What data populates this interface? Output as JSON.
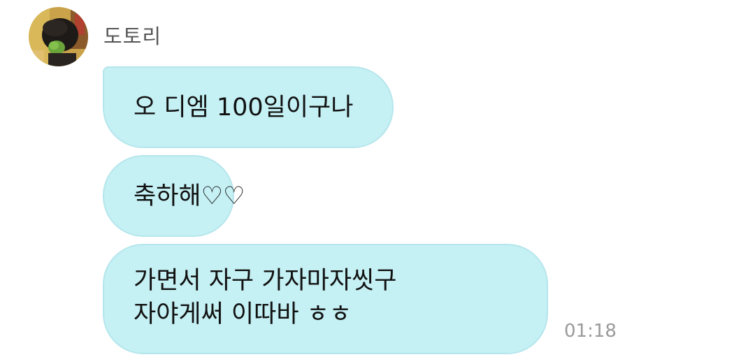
{
  "sender": {
    "name": "도토리",
    "avatar_icon": "profile-photo"
  },
  "messages": [
    {
      "lines": [
        "오 디엠 100일이구나"
      ]
    },
    {
      "lines": [
        "축하해♡♡"
      ]
    },
    {
      "lines": [
        "가면서 자구 가자마자씻구",
        "자야게써 이따바 ㅎㅎ"
      ]
    }
  ],
  "timestamp": "01:18",
  "colors": {
    "bubble": "#c5f0f4",
    "bubble_border": "#b5e6ec",
    "text": "#111111",
    "name": "#555555",
    "time": "#9a9a9a"
  }
}
